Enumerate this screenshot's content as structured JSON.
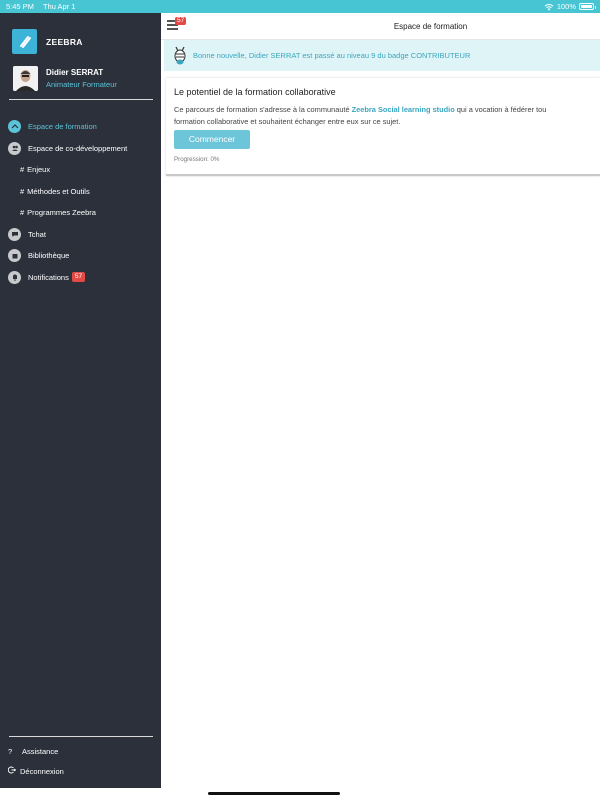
{
  "status": {
    "time": "5:45 PM",
    "date": "Thu Apr 1",
    "battery": "100%"
  },
  "brand": {
    "name": "ZEEBRA"
  },
  "user": {
    "name": "Didier SERRAT",
    "role": "Animateur Formateur"
  },
  "nav": {
    "items": [
      {
        "label": "Espace de formation"
      },
      {
        "label": "Espace de co-développement"
      },
      {
        "label": "Enjeux"
      },
      {
        "label": "Méthodes et Outils"
      },
      {
        "label": "Programmes Zeebra"
      },
      {
        "label": "Tchat"
      },
      {
        "label": "Bibliothèque"
      },
      {
        "label": "Notifications",
        "badge": "57"
      }
    ],
    "hash": "#"
  },
  "bottom": {
    "assistance": "Assistance",
    "assistance_icon": "?",
    "logout": "Déconnexion"
  },
  "header": {
    "title": "Espace de formation",
    "badge": "57"
  },
  "notice": {
    "text": "Bonne nouvelle, Didier SERRAT est passé au niveau 9 du badge CONTRIBUTEUR"
  },
  "course": {
    "title": "Le potentiel de la formation collaborative",
    "desc_before": "Ce parcours de formation s'adresse à la communauté ",
    "desc_highlight": "Zeebra Social learning studio",
    "desc_after": " qui a vocation à fédérer tou",
    "desc_line2": "formation collaborative et souhaitent échanger entre eux sur ce sujet.",
    "button": "Commencer",
    "progress": "Progression: 0%"
  },
  "colors": {
    "accent": "#48c5d3",
    "sidebar": "#2b303b",
    "badge": "#e34a45"
  }
}
